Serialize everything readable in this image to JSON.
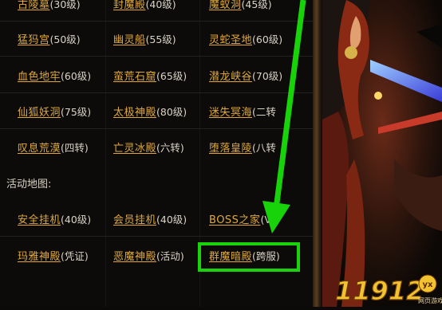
{
  "rows": [
    {
      "cells": [
        {
          "name": "古陵墓",
          "level": "(30级)"
        },
        {
          "name": "封魔殿",
          "level": "(40级)"
        },
        {
          "name": "魔蚁洞",
          "level": "(45级)"
        }
      ]
    },
    {
      "cells": [
        {
          "name": "猛犸宫",
          "level": "(50级)"
        },
        {
          "name": "幽灵船",
          "level": "(55级)"
        },
        {
          "name": "灵蛇圣地",
          "level": "(60级)"
        }
      ]
    },
    {
      "cells": [
        {
          "name": "血色地牢",
          "level": "(60级)"
        },
        {
          "name": "蛮荒石窟",
          "level": "(65级)"
        },
        {
          "name": "潜龙峡谷",
          "level": "(70级)"
        }
      ]
    },
    {
      "cells": [
        {
          "name": "仙狐妖洞",
          "level": "(75级)"
        },
        {
          "name": "太极神殿",
          "level": "(80级)"
        },
        {
          "name": "迷失冥海",
          "level": "(二转"
        }
      ]
    },
    {
      "cells": [
        {
          "name": "叹息荒漠",
          "level": "(四转)"
        },
        {
          "name": "亡灵冰殿",
          "level": "(六转)"
        },
        {
          "name": "堕落皇陵",
          "level": "(八转"
        }
      ]
    }
  ],
  "activity": {
    "title": "活动地图:",
    "rows": [
      {
        "cells": [
          {
            "name": "安全挂机",
            "level": "(40级)"
          },
          {
            "name": "会员挂机",
            "level": "(40级)"
          },
          {
            "name": "BOSS之家",
            "level": "(VI"
          }
        ]
      },
      {
        "cells": [
          {
            "name": "玛雅神殿",
            "level": "(凭证)"
          },
          {
            "name": "恶魔神殿",
            "level": "(活动)"
          },
          {
            "name": "群魔暗殿",
            "level": "(跨服)"
          }
        ]
      }
    ]
  },
  "logo": {
    "text": "11912",
    "badge": "yx",
    "sub": "网页游戏"
  },
  "colors": {
    "link": "#dfa83a",
    "level": "#d9d3c6",
    "highlight": "#19d30a",
    "background": "#0c0b0a"
  }
}
